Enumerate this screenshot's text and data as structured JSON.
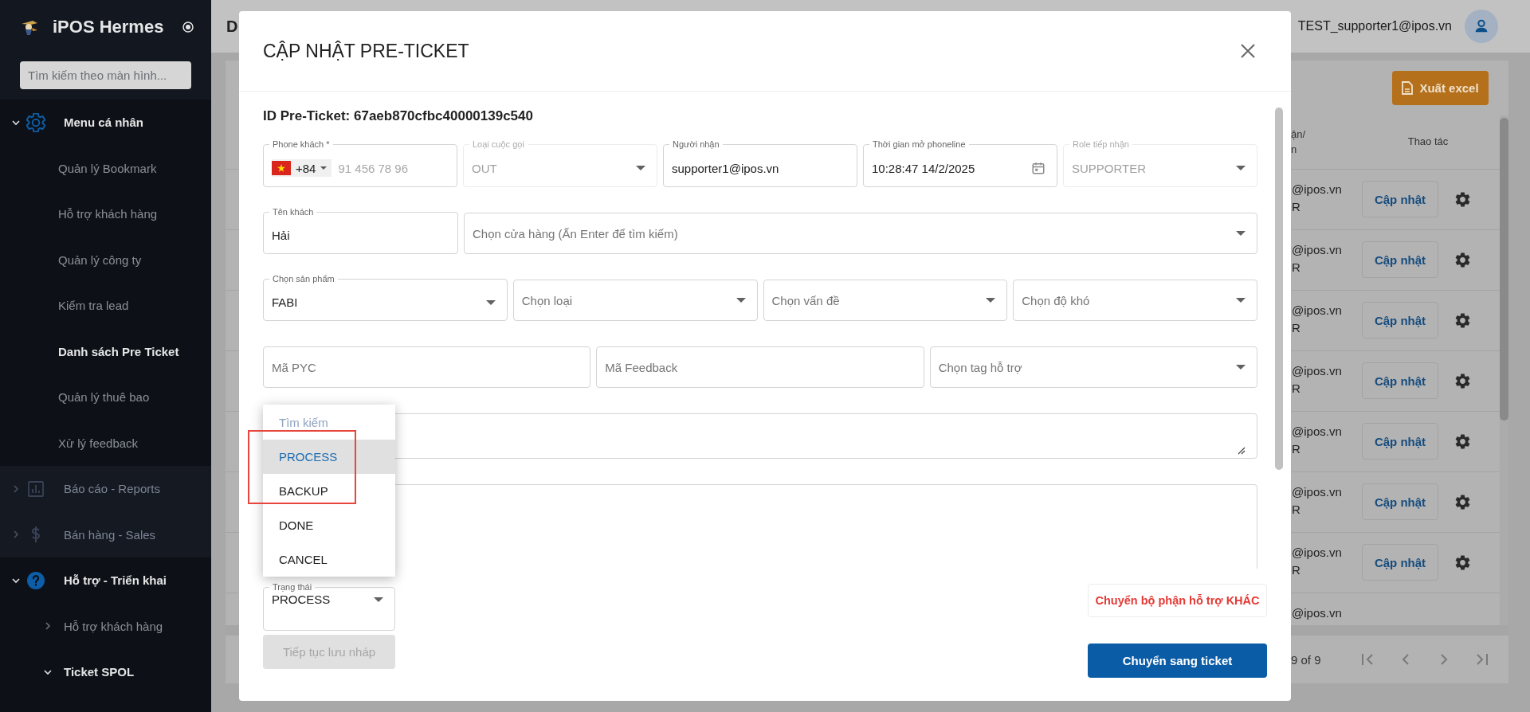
{
  "sidebar": {
    "brand": "iPOS Hermes",
    "search": {
      "placeholder": "Tìm kiếm theo màn hình..."
    },
    "groups": [
      {
        "label": "Menu cá nhân",
        "expanded": true,
        "children": [
          {
            "label": "Quản lý Bookmark",
            "selected": false
          },
          {
            "label": "Hỗ trợ khách hàng",
            "selected": false
          },
          {
            "label": "Quản lý công ty",
            "selected": false
          },
          {
            "label": "Kiểm tra lead",
            "selected": false
          },
          {
            "label": "Danh sách Pre Ticket",
            "selected": true
          },
          {
            "label": "Quản lý thuê bao",
            "selected": false
          },
          {
            "label": "Xử lý feedback",
            "selected": false
          }
        ]
      },
      {
        "label": "Báo cáo - Reports",
        "expanded": false
      },
      {
        "label": "Bán hàng - Sales",
        "expanded": false
      },
      {
        "label": "Hỗ trợ - Triển khai",
        "expanded": true,
        "children": [
          {
            "label": "Hỗ trợ khách hàng",
            "expanded": false
          },
          {
            "label": "Ticket SPOL",
            "expanded": true
          }
        ]
      }
    ]
  },
  "header": {
    "title": "D",
    "user": "TEST_supporter1@ipos.vn"
  },
  "table": {
    "export_button": "Xuất excel",
    "columns": [
      "ận/\nn",
      "Thao tác"
    ],
    "rows": [
      {
        "cell": "@ipos.vn\nR",
        "action": "Cập nhật"
      },
      {
        "cell": "@ipos.vn\nR",
        "action": "Cập nhật"
      },
      {
        "cell": "@ipos.vn\nR",
        "action": "Cập nhật"
      },
      {
        "cell": "@ipos.vn\nR",
        "action": "Cập nhật"
      },
      {
        "cell": "@ipos.vn\nR",
        "action": "Cập nhật"
      },
      {
        "cell": "@ipos.vn\nR",
        "action": "Cập nhật"
      },
      {
        "cell": "@ipos.vn\nR",
        "action": "Cập nhật"
      },
      {
        "cell": "@ipos.vn"
      }
    ]
  },
  "pagination": {
    "range": "9 of 9"
  },
  "modal": {
    "title": "CẬP NHẬT PRE-TICKET",
    "id_label": "ID Pre-Ticket: 67aeb870cfbc40000139c540",
    "rows": [
      [
        {
          "kind": "phone",
          "label": "Phone khách *",
          "dial_code": "+84",
          "placeholder": "91 456 78 96",
          "disabled": false
        },
        {
          "kind": "select",
          "label": "Loại cuộc gọi",
          "value": "OUT",
          "disabled": true
        },
        {
          "kind": "text",
          "label": "Người nhận",
          "value": "supporter1@ipos.vn",
          "disabled": false
        },
        {
          "kind": "date",
          "label": "Thời gian mở phoneline",
          "value": "10:28:47 14/2/2025",
          "disabled": false
        },
        {
          "kind": "select",
          "label": "Role tiếp nhận",
          "value": "SUPPORTER",
          "disabled": true
        }
      ],
      [
        {
          "kind": "text",
          "label": "Tên khách",
          "value": "Hải",
          "disabled": false
        },
        {
          "kind": "select",
          "placeholder": "Chọn cửa hàng (Ấn Enter để tìm kiếm)",
          "disabled": false
        }
      ],
      [
        {
          "kind": "select",
          "label": "Chọn sản phẩm",
          "value": "FABI",
          "disabled": false
        },
        {
          "kind": "select",
          "placeholder": "Chọn loại",
          "disabled": false
        },
        {
          "kind": "select",
          "placeholder": "Chọn vấn đề",
          "disabled": false
        },
        {
          "kind": "select",
          "placeholder": "Chọn độ khó",
          "disabled": false
        }
      ],
      [
        {
          "kind": "text",
          "placeholder": "Mã PYC",
          "disabled": false
        },
        {
          "kind": "text",
          "placeholder": "Mã Feedback",
          "disabled": false
        },
        {
          "kind": "select",
          "placeholder": "Chọn tag hỗ trợ",
          "disabled": false
        }
      ],
      [
        {
          "kind": "textarea",
          "disabled": false
        }
      ],
      [
        {
          "kind": "textarea",
          "disabled": false
        }
      ]
    ],
    "status": {
      "label": "Trạng thái",
      "value": "PROCESS"
    },
    "status_menu": {
      "search_placeholder": "Tìm kiếm",
      "options": [
        {
          "label": "PROCESS",
          "selected": true
        },
        {
          "label": "BACKUP",
          "selected": false
        },
        {
          "label": "DONE",
          "selected": false
        },
        {
          "label": "CANCEL",
          "selected": false
        }
      ]
    },
    "buttons": [
      {
        "kind": "draft",
        "label": "Tiếp tục lưu nháp",
        "disabled": true
      },
      {
        "kind": "transfer",
        "label": "Chuyển bộ phận hỗ trợ KHÁC",
        "disabled": false
      },
      {
        "kind": "submit",
        "label": "Chuyển sang ticket",
        "disabled": false
      }
    ]
  }
}
